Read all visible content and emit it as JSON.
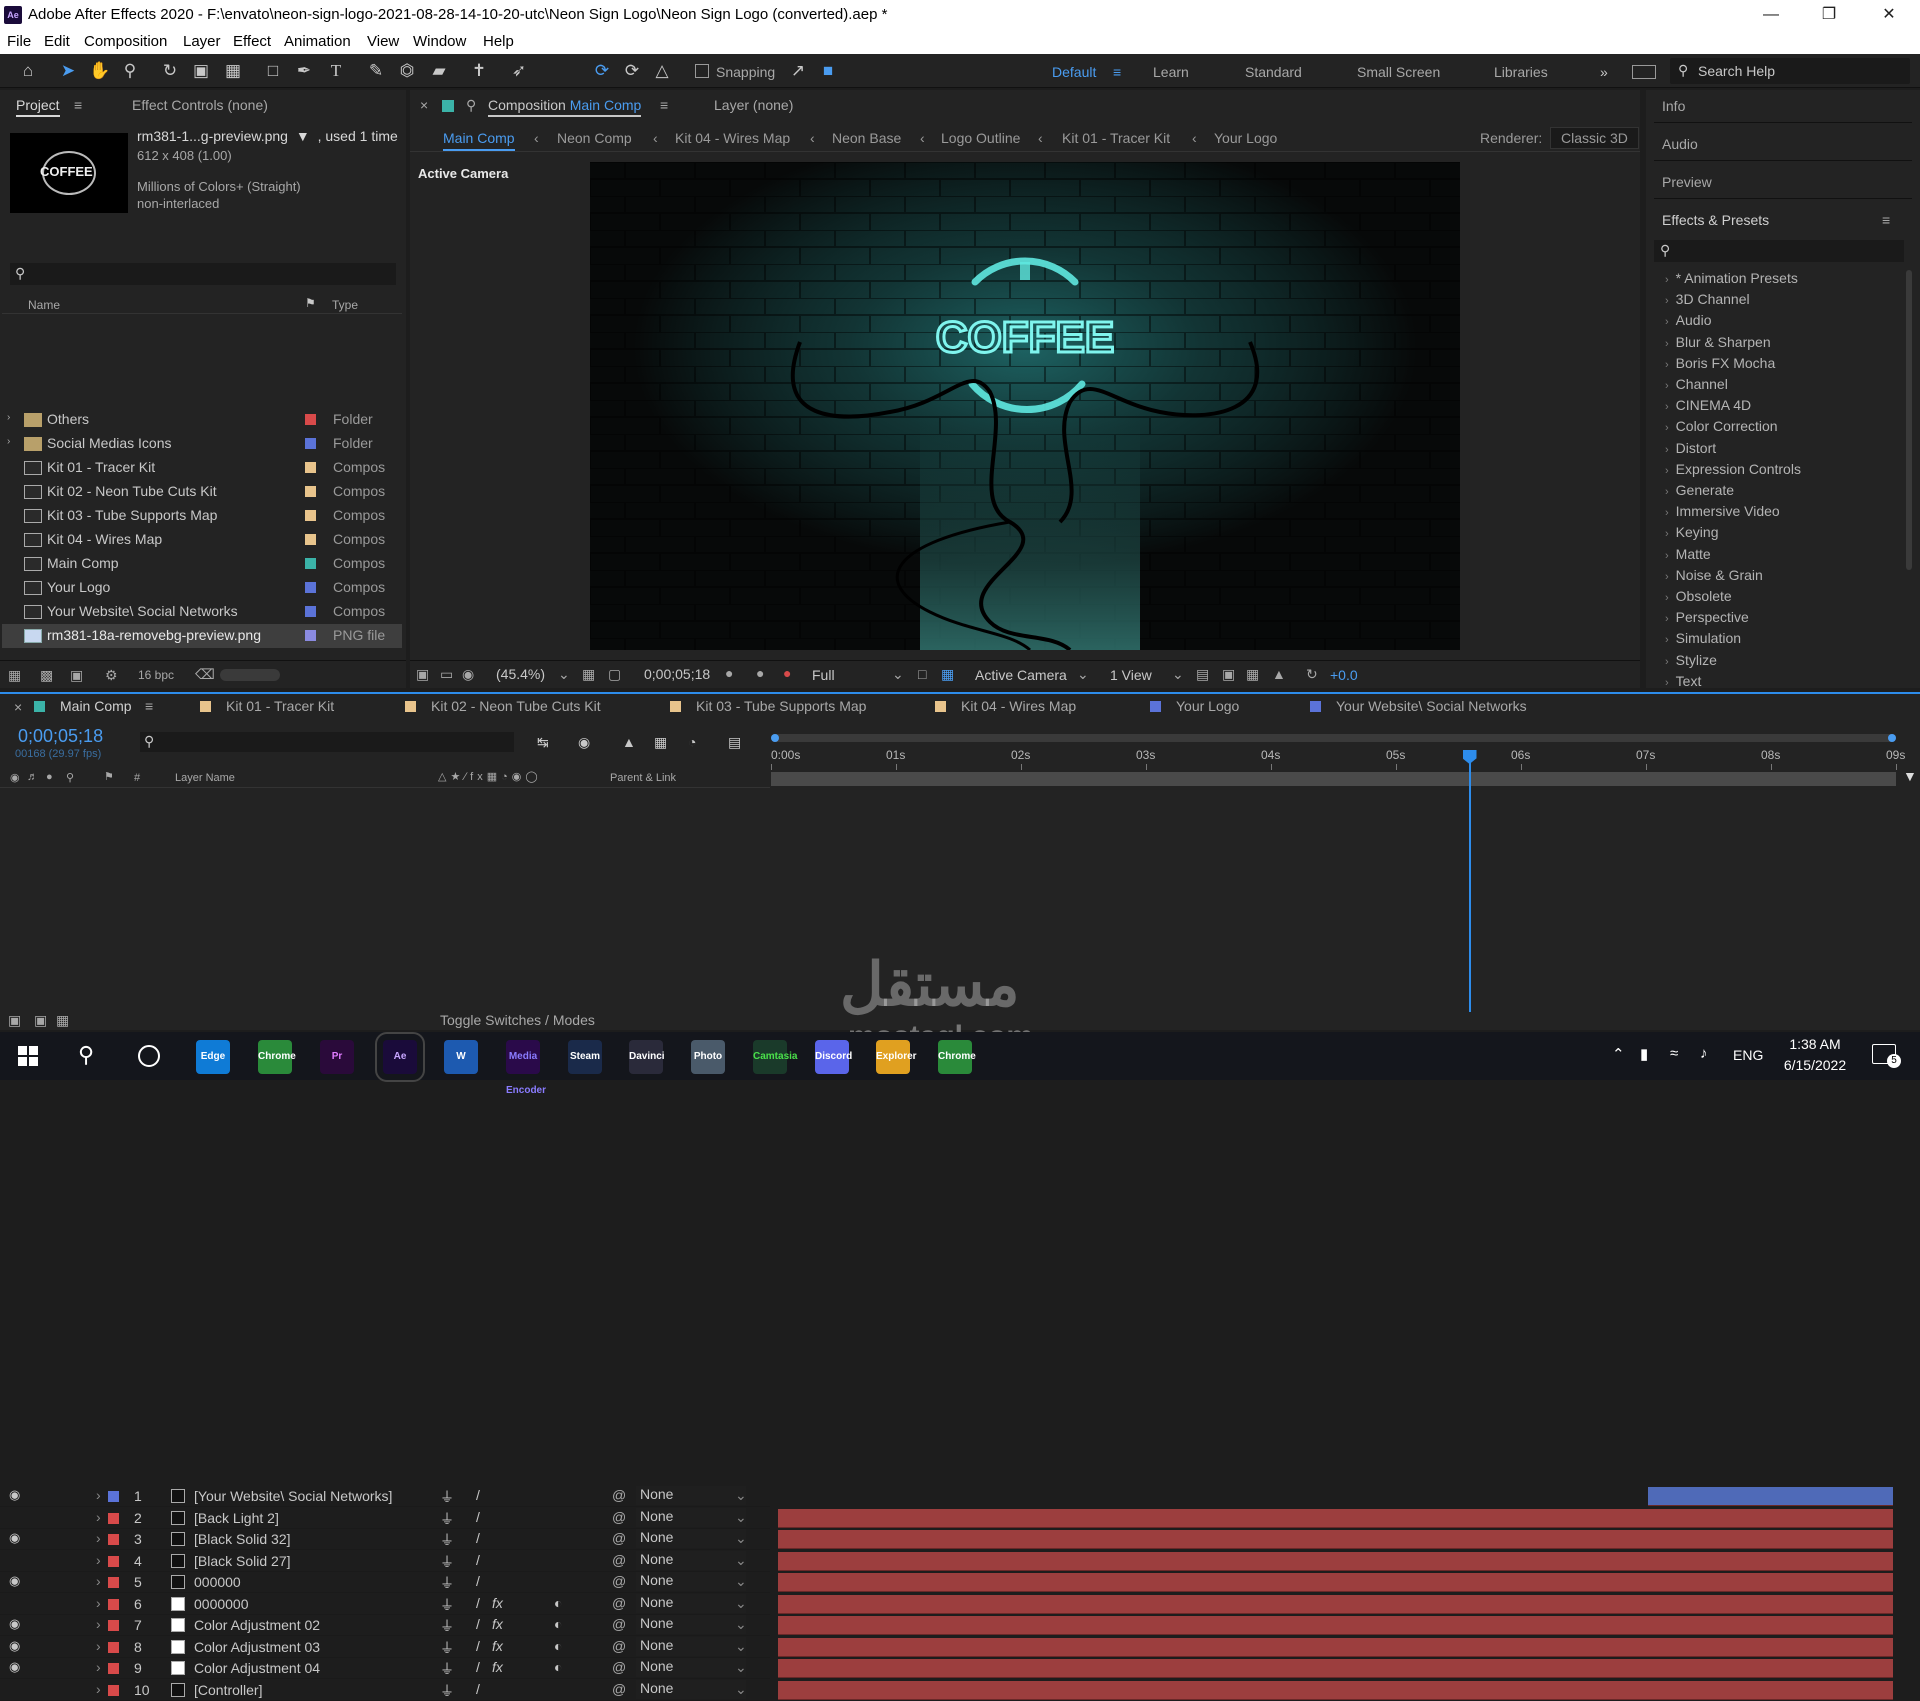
{
  "window": {
    "title": "Adobe After Effects 2020 - F:\\envato\\neon-sign-logo-2021-08-28-14-10-20-utc\\Neon Sign Logo\\Neon Sign Logo (converted).aep *",
    "app_badge": "Ae"
  },
  "menu": [
    "File",
    "Edit",
    "Composition",
    "Layer",
    "Effect",
    "Animation",
    "View",
    "Window",
    "Help"
  ],
  "toolbar": {
    "snapping_label": "Snapping",
    "workspaces": [
      "Default",
      "Learn",
      "Standard",
      "Small Screen",
      "Libraries"
    ],
    "active_workspace": "Default",
    "search_placeholder": "Search Help"
  },
  "project_panel": {
    "tab_project": "Project",
    "tab_effect_controls": "Effect Controls (none)",
    "preview_name": "rm381-1...g-preview.png",
    "preview_used": ", used 1 time",
    "preview_dims": "612 x 408 (1.00)",
    "preview_colors": "Millions of Colors+ (Straight)",
    "preview_interlace": "non-interlaced",
    "thumb_text": "COFFEE",
    "col_name": "Name",
    "col_type": "Type",
    "bpc": "16 bpc",
    "items": [
      {
        "name": "Others",
        "type": "Folder",
        "color": "#d84a4a",
        "kind": "folder"
      },
      {
        "name": "Social Medias Icons",
        "type": "Folder",
        "color": "#5b73d8",
        "kind": "folder"
      },
      {
        "name": "Kit 01 - Tracer Kit",
        "type": "Compos",
        "color": "#e8c48c",
        "kind": "comp"
      },
      {
        "name": "Kit 02 - Neon Tube Cuts Kit",
        "type": "Compos",
        "color": "#e8c48c",
        "kind": "comp"
      },
      {
        "name": "Kit 03 - Tube Supports Map",
        "type": "Compos",
        "color": "#e8c48c",
        "kind": "comp"
      },
      {
        "name": "Kit 04 - Wires Map",
        "type": "Compos",
        "color": "#e8c48c",
        "kind": "comp"
      },
      {
        "name": "Main Comp",
        "type": "Compos",
        "color": "#3bb3a8",
        "kind": "comp"
      },
      {
        "name": "Your Logo",
        "type": "Compos",
        "color": "#5b73d8",
        "kind": "comp"
      },
      {
        "name": "Your Website\\ Social Networks",
        "type": "Compos",
        "color": "#5b73d8",
        "kind": "comp"
      },
      {
        "name": "rm381-18a-removebg-preview.png",
        "type": "PNG file",
        "color": "#8a8ae0",
        "kind": "png",
        "selected": true
      }
    ]
  },
  "comp_panel": {
    "tab_label": "Composition",
    "tab_comp_name": "Main Comp",
    "layer_tab": "Layer  (none)",
    "breadcrumbs": [
      "Main Comp",
      "Neon Comp",
      "Kit 04 - Wires Map",
      "Neon Base",
      "Logo Outline",
      "Kit 01 - Tracer Kit",
      "Your Logo"
    ],
    "renderer_label": "Renderer:",
    "renderer_value": "Classic 3D",
    "active_camera_label": "Active Camera",
    "neon_text": "COFFEE",
    "zoom": "(45.4%)",
    "timecode": "0;00;05;18",
    "resolution": "Full",
    "view_camera": "Active Camera",
    "view_count": "1 View",
    "exposure": "+0.0"
  },
  "right_panel": {
    "sections": [
      "Info",
      "Audio",
      "Preview"
    ],
    "effects_title": "Effects & Presets",
    "effects": [
      "* Animation Presets",
      "3D Channel",
      "Audio",
      "Blur & Sharpen",
      "Boris FX Mocha",
      "Channel",
      "CINEMA 4D",
      "Color Correction",
      "Distort",
      "Expression Controls",
      "Generate",
      "Immersive Video",
      "Keying",
      "Matte",
      "Noise & Grain",
      "Obsolete",
      "Perspective",
      "Simulation",
      "Stylize",
      "Text"
    ]
  },
  "timeline": {
    "tabs": [
      {
        "name": "Main Comp",
        "color": "#3bb3a8"
      },
      {
        "name": "Kit 01 - Tracer Kit",
        "color": "#e8c48c"
      },
      {
        "name": "Kit 02 - Neon Tube Cuts Kit",
        "color": "#e8c48c"
      },
      {
        "name": "Kit 03 - Tube Supports Map",
        "color": "#e8c48c"
      },
      {
        "name": "Kit 04 - Wires Map",
        "color": "#e8c48c"
      },
      {
        "name": "Your Logo",
        "color": "#5b73d8"
      },
      {
        "name": "Your Website\\ Social Networks",
        "color": "#5b73d8"
      }
    ],
    "timecode": "0;00;05;18",
    "frames": "00168 (29.97 fps)",
    "col_layer_name": "Layer Name",
    "col_parent": "Parent & Link",
    "col_hash": "#",
    "ruler": [
      "0:00s",
      "01s",
      "02s",
      "03s",
      "04s",
      "05s",
      "06s",
      "07s",
      "08s",
      "09s"
    ],
    "playhead_fraction": 0.62,
    "toggle_label": "Toggle Switches / Modes",
    "layers": [
      {
        "num": "1",
        "name": "[Your Website\\ Social Networks]",
        "color": "#5b73d8",
        "eye": true,
        "fx": false,
        "parent": "None",
        "bar_color": "#4f6ab8",
        "bar_start": 0.78
      },
      {
        "num": "2",
        "name": "[Back Light 2]",
        "color": "#d84a4a",
        "eye": false,
        "fx": false,
        "parent": "None"
      },
      {
        "num": "3",
        "name": "[Black Solid 32]",
        "color": "#d84a4a",
        "eye": true,
        "fx": false,
        "parent": "None"
      },
      {
        "num": "4",
        "name": "[Black Solid 27]",
        "color": "#d84a4a",
        "eye": false,
        "fx": false,
        "parent": "None"
      },
      {
        "num": "5",
        "name": "000000",
        "color": "#d84a4a",
        "eye": true,
        "fx": false,
        "parent": "None"
      },
      {
        "num": "6",
        "name": "0000000",
        "color": "#d84a4a",
        "eye": false,
        "fx": true,
        "parent": "None"
      },
      {
        "num": "7",
        "name": "Color Adjustment 02",
        "color": "#d84a4a",
        "eye": true,
        "fx": true,
        "parent": "None"
      },
      {
        "num": "8",
        "name": "Color Adjustment 03",
        "color": "#d84a4a",
        "eye": true,
        "fx": true,
        "parent": "None"
      },
      {
        "num": "9",
        "name": "Color Adjustment 04",
        "color": "#d84a4a",
        "eye": true,
        "fx": true,
        "parent": "None"
      },
      {
        "num": "10",
        "name": "[Controller]",
        "color": "#d84a4a",
        "eye": false,
        "fx": false,
        "parent": "None"
      }
    ]
  },
  "watermark": {
    "arabic": "مستقل",
    "latin": "mostaql.com"
  },
  "taskbar": {
    "time": "1:38 AM",
    "date": "6/15/2022",
    "lang": "ENG",
    "notif_count": "5",
    "apps": [
      "Edge",
      "Chrome",
      "Pr",
      "Ae",
      "W",
      "Media Encoder",
      "Steam",
      "Davinci",
      "Photo",
      "Camtasia",
      "Discord",
      "Explorer",
      "Chrome"
    ]
  },
  "colors": {
    "accent": "#2d8ceb",
    "playhead": "#2d8ceb",
    "layer_bar": "#9c3e3e"
  }
}
